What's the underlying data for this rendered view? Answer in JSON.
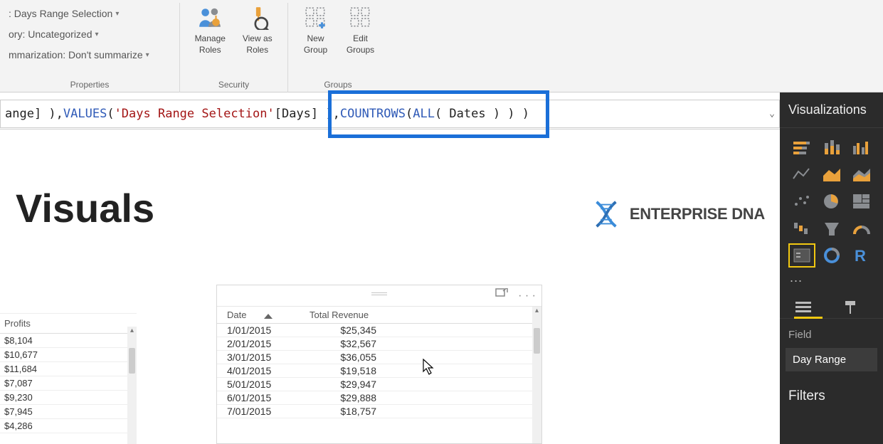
{
  "ribbon": {
    "properties": {
      "name_row": ": Days Range Selection",
      "category_row": "ory: Uncategorized",
      "summarize_row": "mmarization: Don't summarize",
      "group_label": "Properties"
    },
    "security": {
      "manage_roles_label": "Manage\nRoles",
      "view_as_roles_label": "View as\nRoles",
      "group_label": "Security"
    },
    "groups": {
      "new_group_label": "New\nGroup",
      "edit_groups_label": "Edit\nGroups",
      "group_label": "Groups"
    }
  },
  "formula": {
    "part_black1": "ange] ), ",
    "part_func1": "VALUES",
    "part_paren1": "( ",
    "part_lit1": "'Days Range Selection'",
    "part_col1": "[Days] ), ",
    "part_func2": "COUNTROWS",
    "part_paren2": "( ",
    "part_func3": "ALL",
    "part_paren3": "( Dates ) ) )"
  },
  "main_title": "Visuals",
  "brand_text": "ENTERPRISE DNA",
  "profits": {
    "header": "Profits",
    "rows": [
      "$8,104",
      "$10,677",
      "$11,684",
      "$7,087",
      "$9,230",
      "$7,945",
      "$4,286"
    ]
  },
  "table": {
    "header_date": "Date",
    "header_revenue": "Total Revenue",
    "rows": [
      {
        "date": "1/01/2015",
        "revenue": "$25,345"
      },
      {
        "date": "2/01/2015",
        "revenue": "$32,567"
      },
      {
        "date": "3/01/2015",
        "revenue": "$36,055"
      },
      {
        "date": "4/01/2015",
        "revenue": "$19,518"
      },
      {
        "date": "5/01/2015",
        "revenue": "$29,947"
      },
      {
        "date": "6/01/2015",
        "revenue": "$29,888"
      },
      {
        "date": "7/01/2015",
        "revenue": "$18,757"
      }
    ]
  },
  "viz_panel": {
    "title": "Visualizations",
    "more": "...",
    "field_label": "Field",
    "field_value": "Day Range",
    "filters_title": "Filters"
  }
}
